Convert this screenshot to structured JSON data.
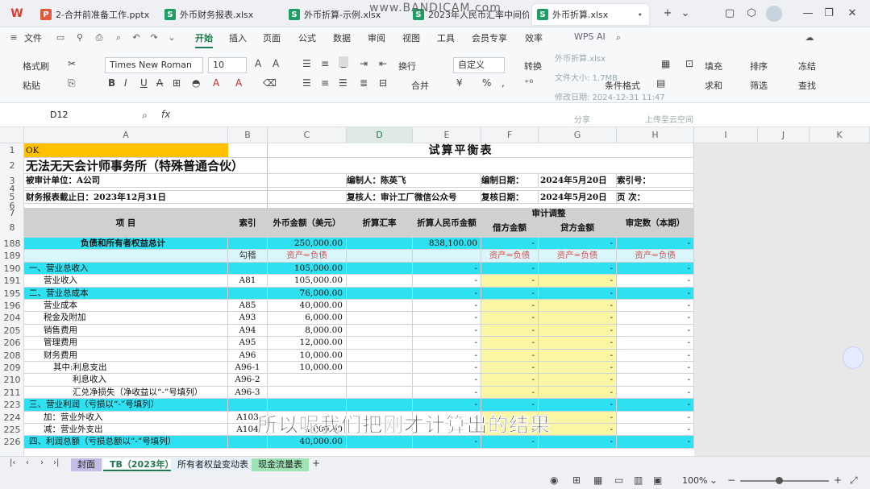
{
  "tabs": [
    {
      "label": "2-合并前准备工作.pptx",
      "type": "P"
    },
    {
      "label": "外币财务报表.xlsx",
      "type": "S"
    },
    {
      "label": "外币折算-示例.xlsx",
      "type": "S"
    },
    {
      "label": "2023年人民币汇率中间价",
      "type": "S"
    },
    {
      "label": "外币折算.xlsx",
      "type": "S"
    }
  ],
  "watermark": "www.BANDICAM.com",
  "menu": {
    "file": "文件",
    "items": [
      "开始",
      "插入",
      "页面",
      "公式",
      "数据",
      "审阅",
      "视图",
      "工具",
      "会员专享",
      "效率"
    ],
    "wps_ai": "WPS AI",
    "share": "分享"
  },
  "ribbon": {
    "format_painter": "格式刷",
    "paste": "粘贴",
    "font": "Times New Roman",
    "size": "10",
    "wrap": "换行",
    "merge": "合并",
    "numfmt": "自定义",
    "convert": "转换",
    "fill": "填充",
    "sort": "排序",
    "freeze": "冻结",
    "cond_format": "条件格式",
    "sum": "求和",
    "filter": "筛选",
    "find": "查找",
    "tip_file": "外币折算.xlsx",
    "tip_size": "文件大小: 1.7MB",
    "tip_time": "修改日期: 2024-12-31 11:47",
    "tip_share": "分享",
    "tip_cloud": "上传至云空间"
  },
  "formula": {
    "cell": "D12",
    "fx": "fx"
  },
  "columns": [
    "A",
    "B",
    "C",
    "D",
    "E",
    "F",
    "G",
    "H",
    "I",
    "J",
    "K"
  ],
  "sheet": {
    "ok": "OK",
    "title": "试算平衡表",
    "firm": "无法无天会计师事务所（特殊普通合伙）",
    "auditee": "被审计单位：A公司",
    "prepared_by": "编制人：陈英飞",
    "prepared_date_label": "编制日期：",
    "prepared_date": "2024年5月20日",
    "index_no": "索引号：",
    "period": "财务报表截止日：2023年12月31日",
    "reviewer": "复核人：审计工厂微信公众号",
    "review_date_label": "复核日期：",
    "review_date": "2024年5月20日",
    "page": "页    次：",
    "hdr_item": "项    目",
    "hdr_index": "索引",
    "hdr_fc": "外币金额（美元）",
    "hdr_rate": "折算汇率",
    "hdr_rmb": "折算人民币金额",
    "hdr_adj": "审计调整",
    "hdr_dr": "借方金额",
    "hdr_cr": "贷方金额",
    "hdr_final": "审定数（本期）",
    "rows": [
      {
        "n": "188",
        "item": "负债和所有者权益总计",
        "idx": "",
        "fc": "250,000.00",
        "rmb": "838,100.00",
        "dr": "-",
        "cr": "-",
        "fin": "-",
        "style": "cyan",
        "bold": true
      },
      {
        "n": "189",
        "item": "",
        "idx": "勾稽",
        "fc": "资产=负债",
        "rmb": "",
        "dr": "资产=负债",
        "cr": "资产=负债",
        "fin": "资产=负债",
        "style": "lcyan"
      },
      {
        "n": "190",
        "item": "一、营业总收入",
        "idx": "",
        "fc": "105,000.00",
        "rmb": "-",
        "dr": "-",
        "cr": "-",
        "fin": "-",
        "style": "cyan"
      },
      {
        "n": "191",
        "item": "营业收入",
        "idx": "A81",
        "fc": "105,000.00",
        "rmb": "-",
        "dr": "-",
        "cr": "-",
        "fin": "-",
        "style": ""
      },
      {
        "n": "195",
        "item": "二、营业总成本",
        "idx": "",
        "fc": "76,000.00",
        "rmb": "-",
        "dr": "-",
        "cr": "-",
        "fin": "-",
        "style": "cyan"
      },
      {
        "n": "196",
        "item": "营业成本",
        "idx": "A85",
        "fc": "40,000.00",
        "rmb": "-",
        "dr": "-",
        "cr": "-",
        "fin": "-",
        "style": ""
      },
      {
        "n": "204",
        "item": "税金及附加",
        "idx": "A93",
        "fc": "6,000.00",
        "rmb": "-",
        "dr": "-",
        "cr": "-",
        "fin": "-",
        "style": ""
      },
      {
        "n": "205",
        "item": "销售费用",
        "idx": "A94",
        "fc": "8,000.00",
        "rmb": "-",
        "dr": "-",
        "cr": "-",
        "fin": "-",
        "style": ""
      },
      {
        "n": "206",
        "item": "管理费用",
        "idx": "A95",
        "fc": "12,000.00",
        "rmb": "-",
        "dr": "-",
        "cr": "-",
        "fin": "-",
        "style": ""
      },
      {
        "n": "208",
        "item": "财务费用",
        "idx": "A96",
        "fc": "10,000.00",
        "rmb": "-",
        "dr": "-",
        "cr": "-",
        "fin": "-",
        "style": ""
      },
      {
        "n": "209",
        "item": "其中:利息支出",
        "idx": "A96-1",
        "fc": "10,000.00",
        "rmb": "-",
        "dr": "-",
        "cr": "-",
        "fin": "-",
        "style": "",
        "ind": 3
      },
      {
        "n": "210",
        "item": "利息收入",
        "idx": "A96-2",
        "fc": "",
        "rmb": "-",
        "dr": "-",
        "cr": "-",
        "fin": "-",
        "style": "",
        "ind": 5
      },
      {
        "n": "211",
        "item": "汇兑净损失（净收益以“-”号填列）",
        "idx": "A96-3",
        "fc": "",
        "rmb": "-",
        "dr": "-",
        "cr": "-",
        "fin": "-",
        "style": "",
        "ind": 5
      },
      {
        "n": "223",
        "item": "三、营业利润（亏损以“-”号填列）",
        "idx": "",
        "fc": "",
        "rmb": "-",
        "dr": "-",
        "cr": "-",
        "fin": "-",
        "style": "cyan"
      },
      {
        "n": "224",
        "item": "加：营业外收入",
        "idx": "A103",
        "fc": "",
        "rmb": "-",
        "dr": "-",
        "cr": "-",
        "fin": "-",
        "style": ""
      },
      {
        "n": "225",
        "item": "减：营业外支出",
        "idx": "A104",
        "fc": "4,000.00",
        "rmb": "-",
        "dr": "-",
        "cr": "-",
        "fin": "-",
        "style": ""
      },
      {
        "n": "226",
        "item": "四、利润总额（亏损总额以“-”号填列）",
        "idx": "",
        "fc": "40,000.00",
        "rmb": "-",
        "dr": "-",
        "cr": "-",
        "fin": "-",
        "style": "cyan"
      }
    ]
  },
  "subtitle": "所以呢我们把刚才计算出的结果",
  "sheet_tabs": [
    "封面",
    "TB（2023年）",
    "所有者权益变动表",
    "现金流量表"
  ],
  "status": {
    "zoom": "100%"
  }
}
